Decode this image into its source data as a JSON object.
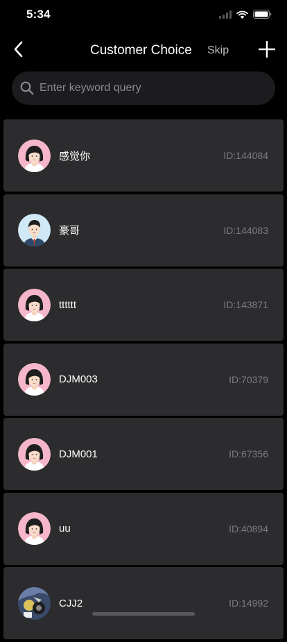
{
  "status_bar": {
    "time": "5:34"
  },
  "nav": {
    "title": "Customer Choice",
    "skip_label": "Skip"
  },
  "search": {
    "placeholder": "Enter keyword query",
    "value": ""
  },
  "customers": [
    {
      "name": "感觉你",
      "id": "ID:144084",
      "avatar": "female-avatar"
    },
    {
      "name": "豪哥",
      "id": "ID:144083",
      "avatar": "male-avatar"
    },
    {
      "name": "tttttt",
      "id": "ID:143871",
      "avatar": "female-avatar"
    },
    {
      "name": "DJM003",
      "id": "ID:70379",
      "avatar": "female-avatar"
    },
    {
      "name": "DJM001",
      "id": "ID:67356",
      "avatar": "female-avatar"
    },
    {
      "name": "uu",
      "id": "ID:40894",
      "avatar": "female-avatar"
    },
    {
      "name": "CJJ2",
      "id": "ID:14992",
      "avatar": "photo-avatar"
    }
  ],
  "colors": {
    "background": "#000000",
    "card": "#2c2c2e",
    "search_bg": "#1c1c1e",
    "id_text": "#7c7c80",
    "female_avatar_bg": "#f4b6c8",
    "male_avatar_bg": "#cfe9f7"
  }
}
